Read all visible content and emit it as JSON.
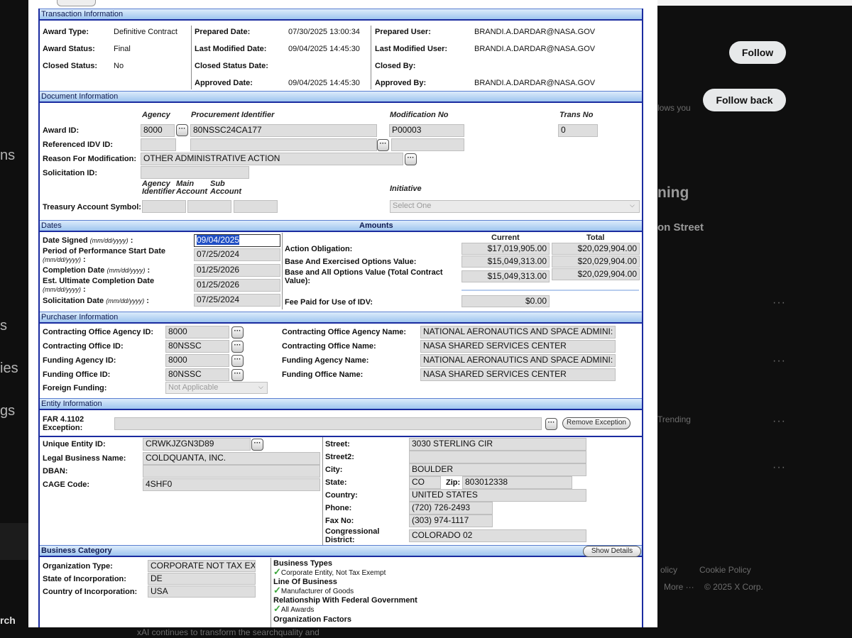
{
  "background": {
    "follow_label": "Follow",
    "follow_back_label": "Follow back",
    "follows_you": "lows you",
    "trending_heading": "ning",
    "street_fragment": "on Street",
    "trending_label": "Trending",
    "footer_privacy": "olicy",
    "footer_cookie": "Cookie Policy",
    "footer_more": "More ···",
    "footer_copyright": "© 2025 X Corp.",
    "left_nav": [
      "ns",
      "s",
      "ies",
      "gs"
    ],
    "bottom_text": "xAI continues to transform the searchquality and",
    "search_fragment": "rch"
  },
  "transaction": {
    "title": "Transaction Information",
    "award_type_label": "Award Type:",
    "award_type": "Definitive Contract",
    "award_status_label": "Award Status:",
    "award_status": "Final",
    "closed_status_label": "Closed Status:",
    "closed_status": "No",
    "prepared_date_label": "Prepared Date:",
    "prepared_date": "07/30/2025 13:00:34",
    "last_modified_date_label": "Last Modified Date:",
    "last_modified_date": "09/04/2025 14:45:30",
    "closed_status_date_label": "Closed Status Date:",
    "approved_date_label": "Approved Date:",
    "approved_date": "09/04/2025 14:45:30",
    "prepared_user_label": "Prepared User:",
    "prepared_user": "BRANDI.A.DARDAR@NASA.GOV",
    "last_modified_user_label": "Last Modified User:",
    "last_modified_user": "BRANDI.A.DARDAR@NASA.GOV",
    "closed_by_label": "Closed By:",
    "approved_by_label": "Approved By:",
    "approved_by": "BRANDI.A.DARDAR@NASA.GOV"
  },
  "document": {
    "title": "Document Information",
    "col_agency": "Agency",
    "col_procurement": "Procurement Identifier",
    "col_modification": "Modification No",
    "col_trans": "Trans No",
    "award_id_label": "Award ID:",
    "award_agency": "8000",
    "award_procurement": "80NSSC24CA177",
    "award_modification": "P00003",
    "award_trans": "0",
    "ref_idv_label": "Referenced IDV ID:",
    "reason_label": "Reason For Modification:",
    "reason": "OTHER ADMINISTRATIVE ACTION",
    "solicitation_label": "Solicitation ID:",
    "col_agency_identifier": "Agency Identifier",
    "col_main_account": "Main Account",
    "col_sub_account": "Sub Account",
    "col_initiative": "Initiative",
    "treasury_label": "Treasury Account Symbol:",
    "initiative_placeholder": "Select One"
  },
  "dates": {
    "title": "Dates",
    "date_signed_label": "Date Signed",
    "date_signed": "09/04/2025",
    "pop_start_label": "Period of Performance Start Date",
    "pop_start": "07/25/2024",
    "completion_label": "Completion Date",
    "completion": "01/25/2026",
    "est_completion_label": "Est. Ultimate Completion Date",
    "est_completion": "01/25/2026",
    "solicitation_date_label": "Solicitation Date",
    "solicitation_date": "07/25/2024",
    "format_hint": "(mm/dd/yyyy)"
  },
  "amounts": {
    "title": "Amounts",
    "col_current": "Current",
    "col_total": "Total",
    "action_obligation_label": "Action Obligation:",
    "action_obligation_current": "$17,019,905.00",
    "action_obligation_total": "$20,029,904.00",
    "base_exercised_label": "Base And Exercised Options Value:",
    "base_exercised_current": "$15,049,313.00",
    "base_exercised_total": "$20,029,904.00",
    "base_all_label": "Base and All Options Value (Total Contract Value):",
    "base_all_current": "$15,049,313.00",
    "base_all_total": "$20,029,904.00",
    "fee_label": "Fee Paid for Use of IDV:",
    "fee": "$0.00"
  },
  "purchaser": {
    "title": "Purchaser Information",
    "co_agency_id_label": "Contracting Office Agency ID:",
    "co_agency_id": "8000",
    "co_id_label": "Contracting Office ID:",
    "co_id": "80NSSC",
    "funding_agency_id_label": "Funding Agency ID:",
    "funding_agency_id": "8000",
    "funding_office_id_label": "Funding Office ID:",
    "funding_office_id": "80NSSC",
    "foreign_funding_label": "Foreign Funding:",
    "foreign_funding": "Not Applicable",
    "co_agency_name_label": "Contracting Office Agency Name:",
    "co_agency_name": "NATIONAL AERONAUTICS AND SPACE ADMINI:",
    "co_name_label": "Contracting Office Name:",
    "co_name": "NASA SHARED SERVICES CENTER",
    "funding_agency_name_label": "Funding Agency Name:",
    "funding_agency_name": "NATIONAL AERONAUTICS AND SPACE ADMINI:",
    "funding_office_name_label": "Funding Office Name:",
    "funding_office_name": "NASA SHARED SERVICES CENTER"
  },
  "entity": {
    "title": "Entity Information",
    "far_label": "FAR 4.1102 Exception:",
    "remove_exception": "Remove Exception",
    "uei_label": "Unique Entity ID:",
    "uei": "CRWKJZGN3D89",
    "legal_name_label": "Legal Business Name:",
    "legal_name": "COLDQUANTA, INC.",
    "dban_label": "DBAN:",
    "cage_label": "CAGE Code:",
    "cage": "4SHF0",
    "street_label": "Street:",
    "street": "3030 STERLING CIR",
    "street2_label": "Street2:",
    "city_label": "City:",
    "city": "BOULDER",
    "state_label": "State:",
    "state": "CO",
    "zip_label": "Zip:",
    "zip": "803012338",
    "country_label": "Country:",
    "country": "UNITED STATES",
    "phone_label": "Phone:",
    "phone": "(720) 726-2493",
    "fax_label": "Fax No:",
    "fax": "(303) 974-1117",
    "congressional_label": "Congressional District:",
    "congressional": "COLORADO 02"
  },
  "business": {
    "title": "Business Category",
    "show_details": "Show Details",
    "org_type_label": "Organization Type:",
    "org_type": "CORPORATE NOT TAX EX",
    "state_inc_label": "State of Incorporation:",
    "state_inc": "DE",
    "country_inc_label": "Country of Incorporation:",
    "country_inc": "USA",
    "business_types_label": "Business Types",
    "business_type_value": "Corporate Entity, Not Tax Exempt",
    "line_of_business_label": "Line Of Business",
    "line_of_business_value": "Manufacturer of Goods",
    "relationship_label": "Relationship With Federal Government",
    "relationship_value": "All Awards",
    "org_factors_label": "Organization Factors"
  }
}
